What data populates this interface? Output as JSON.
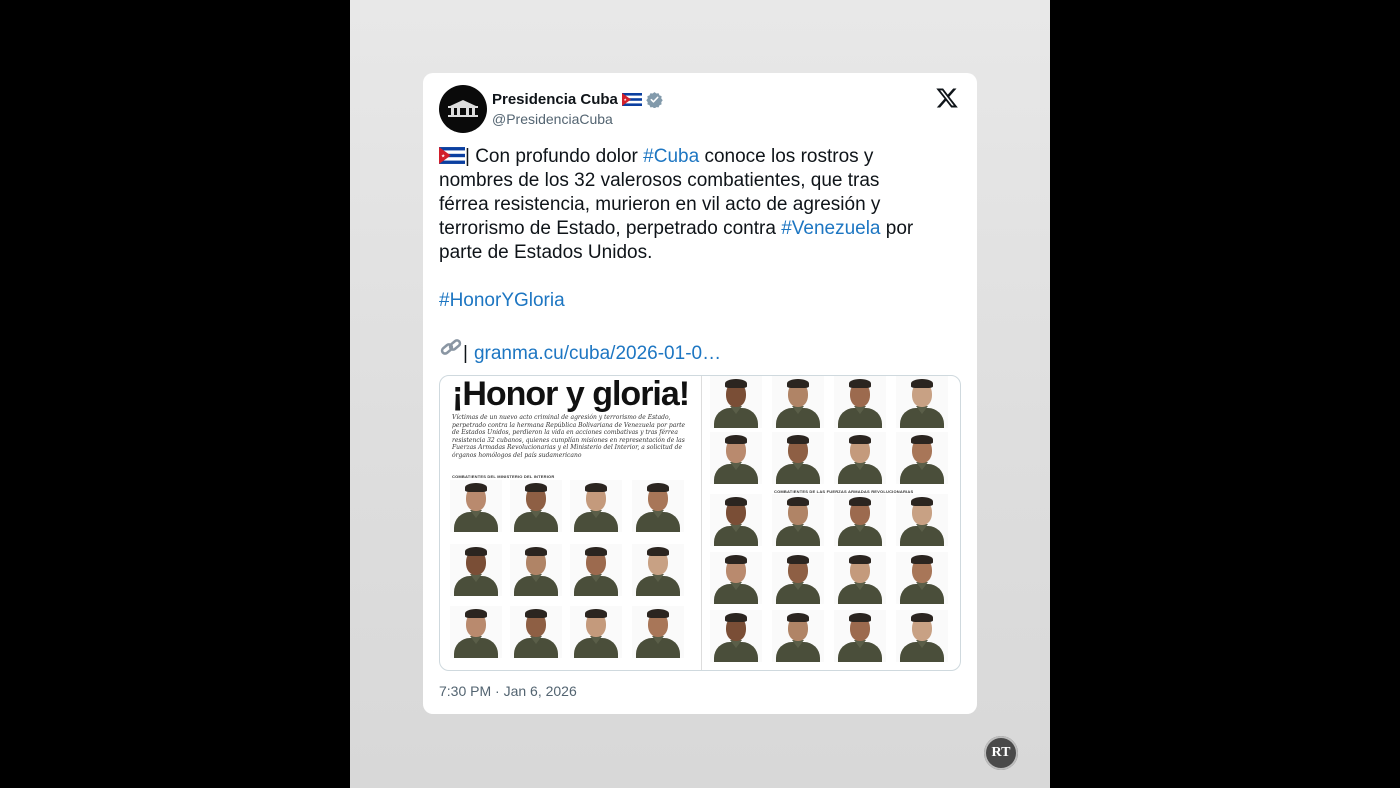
{
  "author": {
    "display_name": "Presidencia Cuba",
    "handle": "@PresidenciaCuba",
    "verified": true,
    "avatar_icon": "presidencia-seal-icon"
  },
  "platform_logo": "x-logo-icon",
  "tweet": {
    "lines": [
      {
        "segments": [
          {
            "text": "| Con profundo dolor "
          },
          {
            "text": "#Cuba",
            "tag": true
          },
          {
            "text": " conoce los rostros y"
          }
        ],
        "leading_flag": true
      },
      {
        "segments": [
          {
            "text": "nombres de los 32 valerosos combatientes, que tras"
          }
        ]
      },
      {
        "segments": [
          {
            "text": "férrea resistencia, murieron en vil acto de agresión y"
          }
        ]
      },
      {
        "segments": [
          {
            "text": "terrorismo de Estado, perpetrado contra "
          },
          {
            "text": "#Venezuela",
            "tag": true
          },
          {
            "text": " por"
          }
        ]
      },
      {
        "segments": [
          {
            "text": "parte de Estados Unidos."
          }
        ]
      }
    ],
    "hashtag_line": "#HonorYGloria",
    "link_prefix": "|",
    "link_text": "granma.cu/cuba/2026-01-0…",
    "timestamp": "7:30 PM · Jan 6, 2026"
  },
  "media": {
    "title": "¡Honor y gloria!",
    "subtitle": "Víctimas de un nuevo acto criminal de agresión y terrorismo de Estado, perpetrado contra la hermana República Bolivariana de Venezuela por parte de Estados Unidos, perdieron la vida en acciones combativas y tras férrea resistencia 32 cubanos, quienes cumplían misiones en representación de las Fuerzas Armadas Revolucionarias y el Ministerio del Interior, a solicitud de órganos homólogos del país sudamericano",
    "section_minint": "COMBATIENTES DEL MINISTERIO DEL INTERIOR",
    "section_far": "COMBATIENTES DE LAS FUERZAS ARMADAS REVOLUCIONARIAS",
    "portrait_count": 32
  },
  "watermark": "RT",
  "colors": {
    "link": "#1d76c2",
    "text": "#0f1419",
    "muted": "#536471",
    "verified": "#829aab"
  }
}
